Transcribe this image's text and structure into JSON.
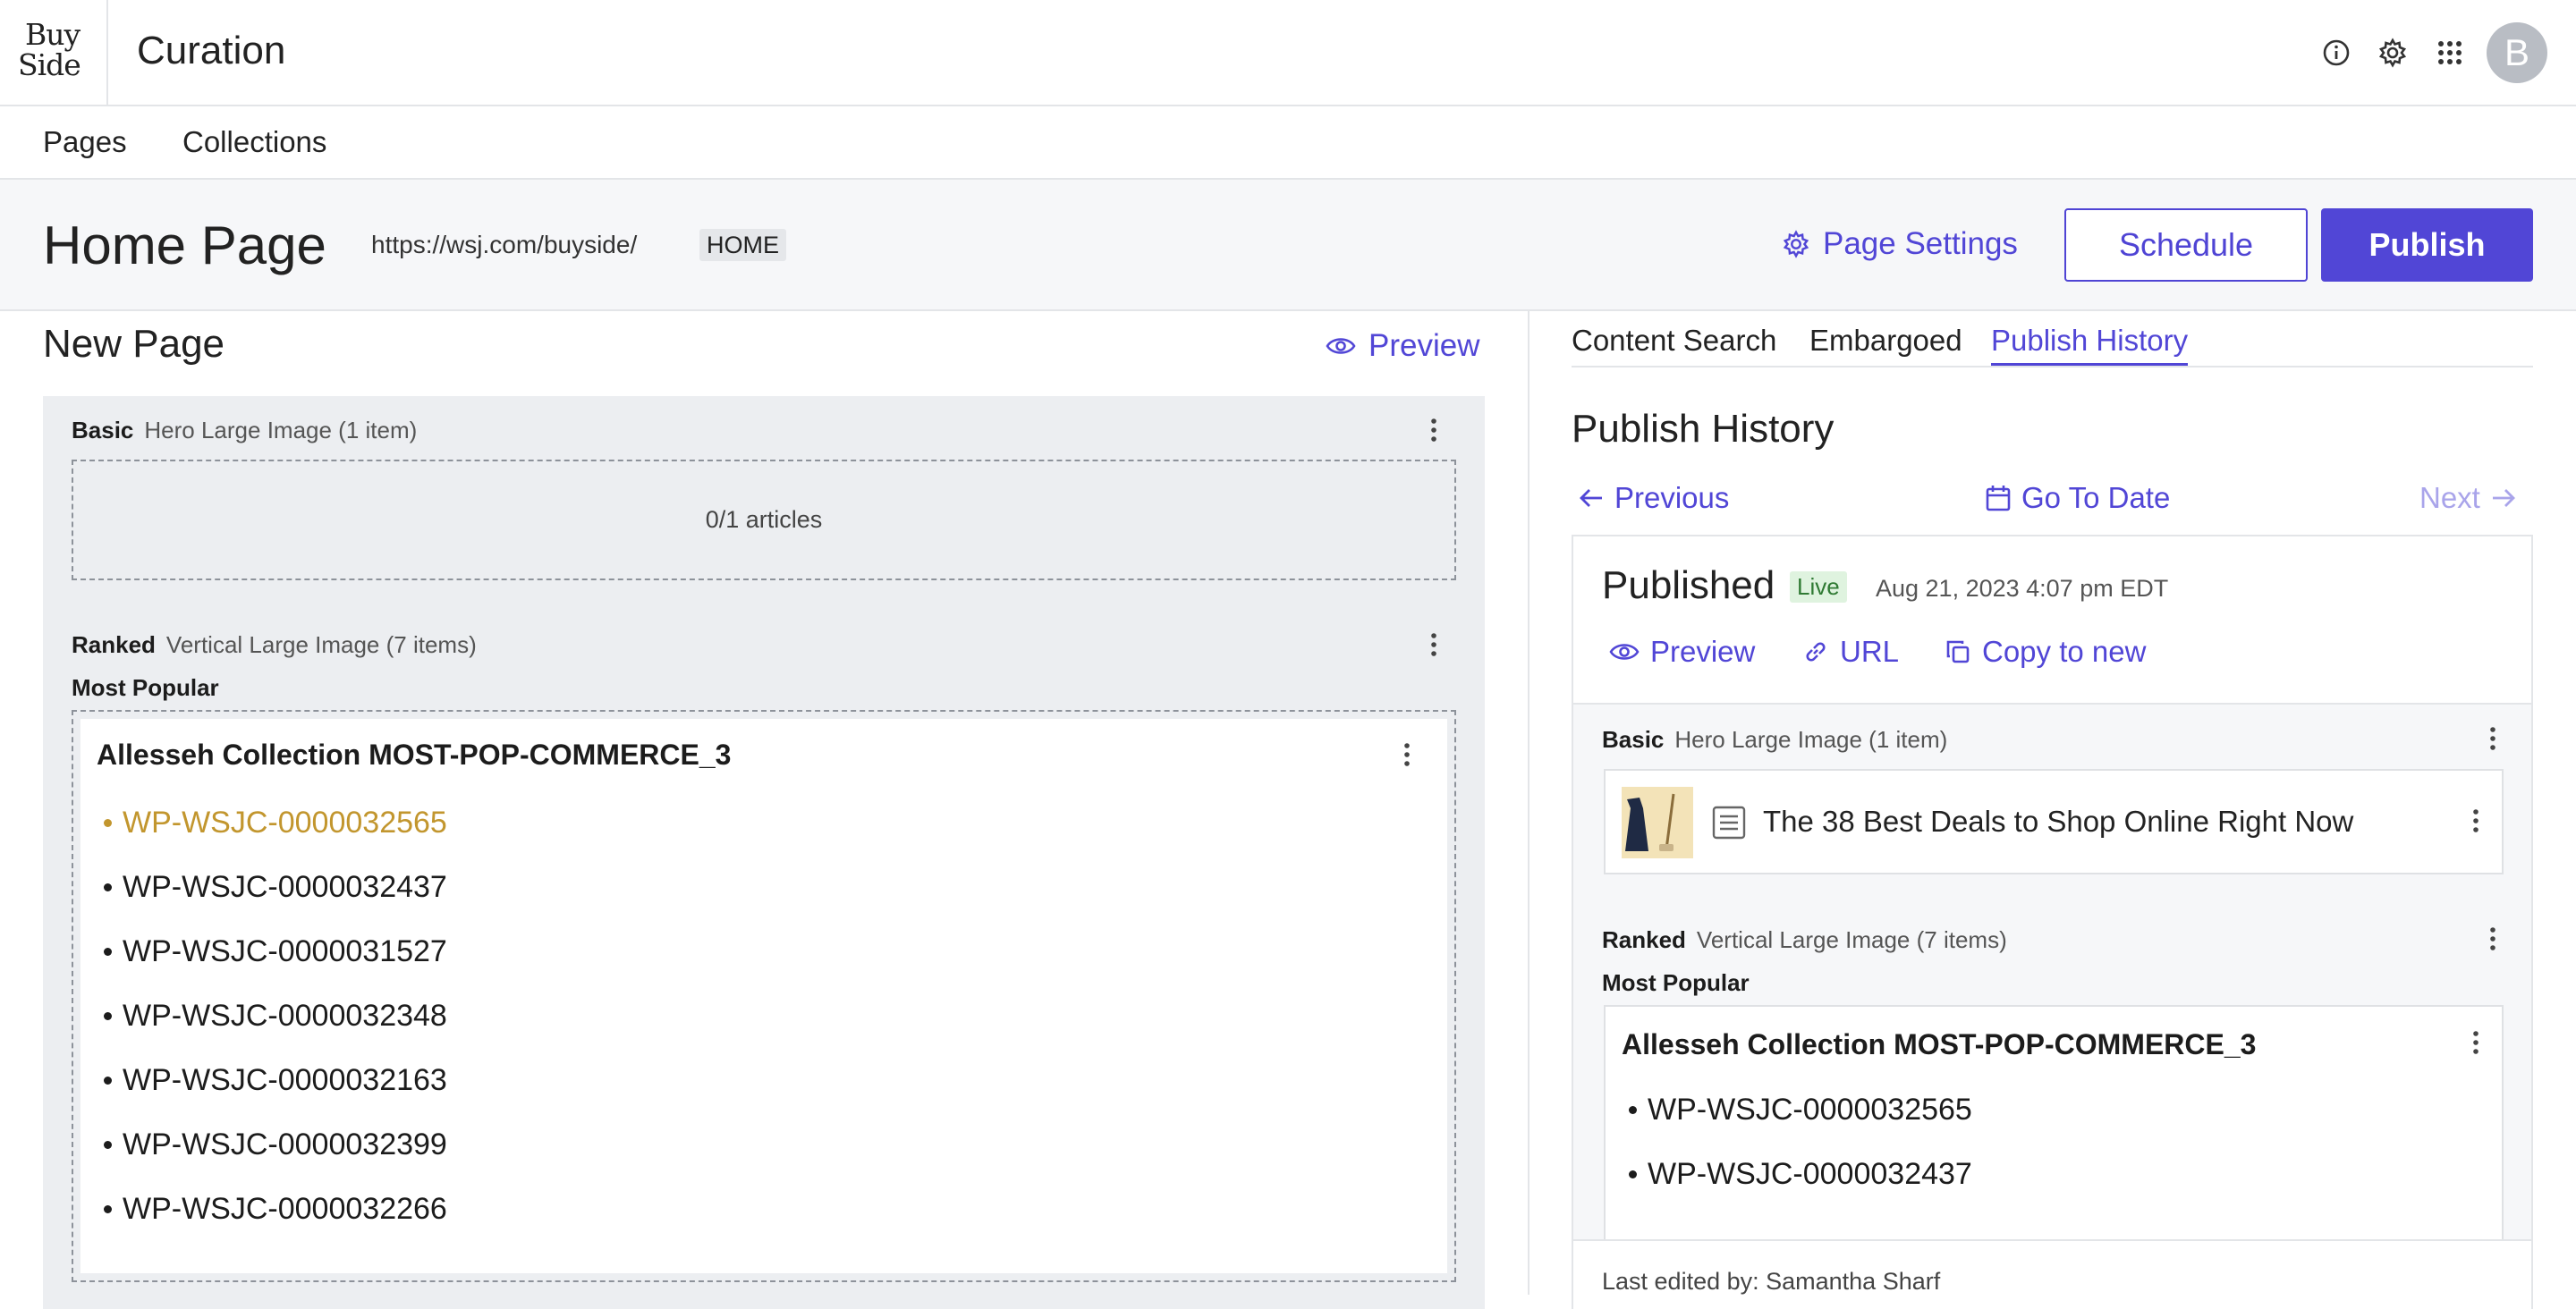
{
  "header": {
    "logo_line1": "Buy",
    "logo_line2": "Side",
    "app_title": "Curation",
    "avatar_initial": "B"
  },
  "nav": {
    "pages": "Pages",
    "collections": "Collections"
  },
  "page": {
    "title": "Home Page",
    "url": "https://wsj.com/buyside/",
    "tag": "HOME",
    "settings_label": "Page Settings",
    "schedule_label": "Schedule",
    "publish_label": "Publish"
  },
  "editor": {
    "title": "New Page",
    "preview_label": "Preview",
    "modules": [
      {
        "type": "Basic",
        "layout": "Hero Large Image (1 item)",
        "articles": "0/1 articles"
      },
      {
        "type": "Ranked",
        "layout": "Vertical Large Image (7 items)",
        "heading": "Most Popular",
        "collection": "Allesseh Collection MOST-POP-COMMERCE_3",
        "items": [
          "WP-WSJC-0000032565",
          "WP-WSJC-0000032437",
          "WP-WSJC-0000031527",
          "WP-WSJC-0000032348",
          "WP-WSJC-0000032163",
          "WP-WSJC-0000032399",
          "WP-WSJC-0000032266"
        ]
      }
    ]
  },
  "right": {
    "tabs": [
      "Content Search",
      "Embargoed",
      "Publish History"
    ],
    "active_tab": "Publish History",
    "title": "Publish History",
    "previous": "Previous",
    "go_to_date": "Go To Date",
    "next": "Next",
    "entry": {
      "status": "Published",
      "badge": "Live",
      "date": "Aug 21, 2023 4:07 pm EDT",
      "preview": "Preview",
      "url": "URL",
      "copy": "Copy to new",
      "basic_type": "Basic",
      "basic_layout": "Hero Large Image (1 item)",
      "article_title": "The 38 Best Deals to Shop Online Right Now",
      "ranked_type": "Ranked",
      "ranked_layout": "Vertical Large Image (7 items)",
      "ranked_heading": "Most Popular",
      "collection": "Allesseh Collection MOST-POP-COMMERCE_3",
      "items": [
        "WP-WSJC-0000032565",
        "WP-WSJC-0000032437"
      ],
      "last_edited": "Last edited by: Samantha Sharf"
    }
  },
  "colors": {
    "accent": "#5146d6",
    "highlight": "#c2962e",
    "live_bg": "#dff3df",
    "live_text": "#2f7a33"
  },
  "icons": [
    "info-icon",
    "gear-icon",
    "apps-grid-icon",
    "eye-icon",
    "kebab-icon",
    "arrow-left-icon",
    "calendar-icon",
    "arrow-right-icon",
    "link-icon",
    "copy-icon",
    "article-doc-icon"
  ]
}
